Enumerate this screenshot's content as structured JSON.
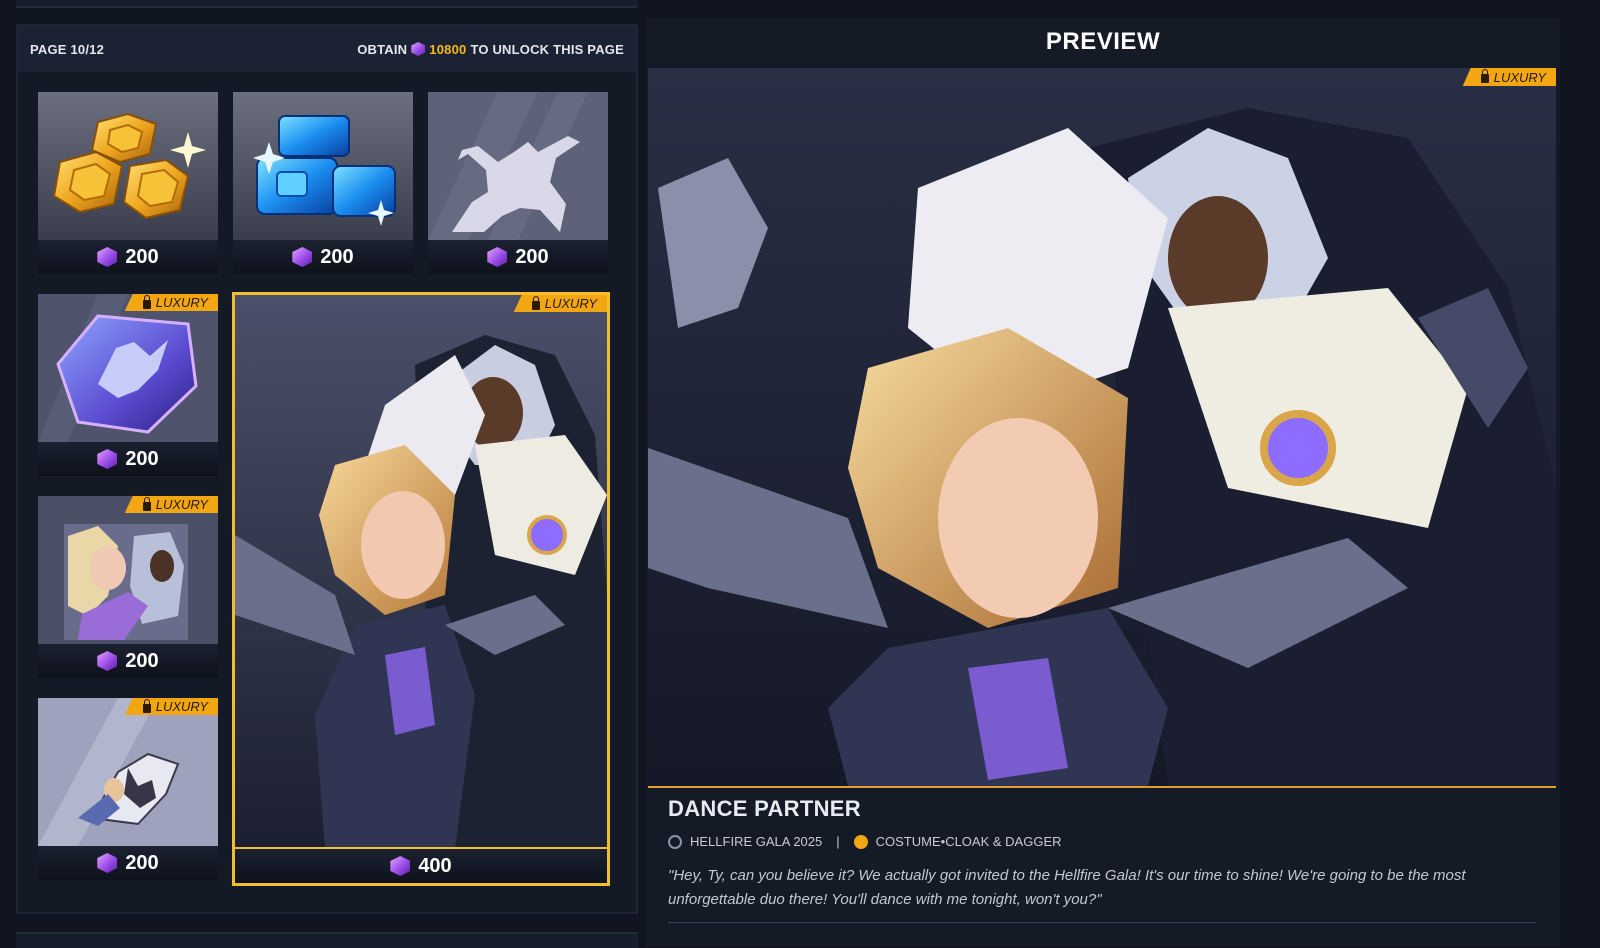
{
  "shop": {
    "page_label": "PAGE 10/12",
    "unlock_prefix": "OBTAIN",
    "unlock_amount": "10800",
    "unlock_suffix": "TO UNLOCK THIS PAGE"
  },
  "tiles": [
    {
      "name": "gold-coin-bundle",
      "price": "200",
      "luxury": false,
      "accent": "#2a2f3c"
    },
    {
      "name": "blue-unit-bundle",
      "price": "200",
      "luxury": false,
      "accent": "#2a2f3c"
    },
    {
      "name": "dance-emote-silhouette",
      "price": "200",
      "luxury": false,
      "accent": "#a35cf0"
    },
    {
      "name": "dance-spray",
      "price": "200",
      "luxury": true,
      "luxury_label": "LUXURY",
      "accent": "#5fb6ff"
    },
    {
      "name": "dance-profile-icon",
      "price": "200",
      "luxury": true,
      "luxury_label": "LUXURY",
      "accent": "#a35cf0"
    },
    {
      "name": "dance-emote",
      "price": "200",
      "luxury": true,
      "luxury_label": "LUXURY",
      "accent": "#f2a712"
    }
  ],
  "featured": {
    "price": "400",
    "luxury_label": "LUXURY"
  },
  "preview": {
    "title": "PREVIEW",
    "luxury_label": "LUXURY",
    "item_name": "DANCE PARTNER",
    "event": "HELLFIRE GALA 2025",
    "separator": "|",
    "category": "COSTUME•CLOAK & DAGGER",
    "quote": "\"Hey, Ty, can you believe it? We actually got invited to the Hellfire Gala! It's our time to shine! We're going to be the most unforgettable duo there! You'll dance with me tonight, won't you?\""
  },
  "colors": {
    "accent_gold": "#f2bd2f",
    "currency_purple": "#a35cf0",
    "luxury_orange": "#f2a712"
  }
}
